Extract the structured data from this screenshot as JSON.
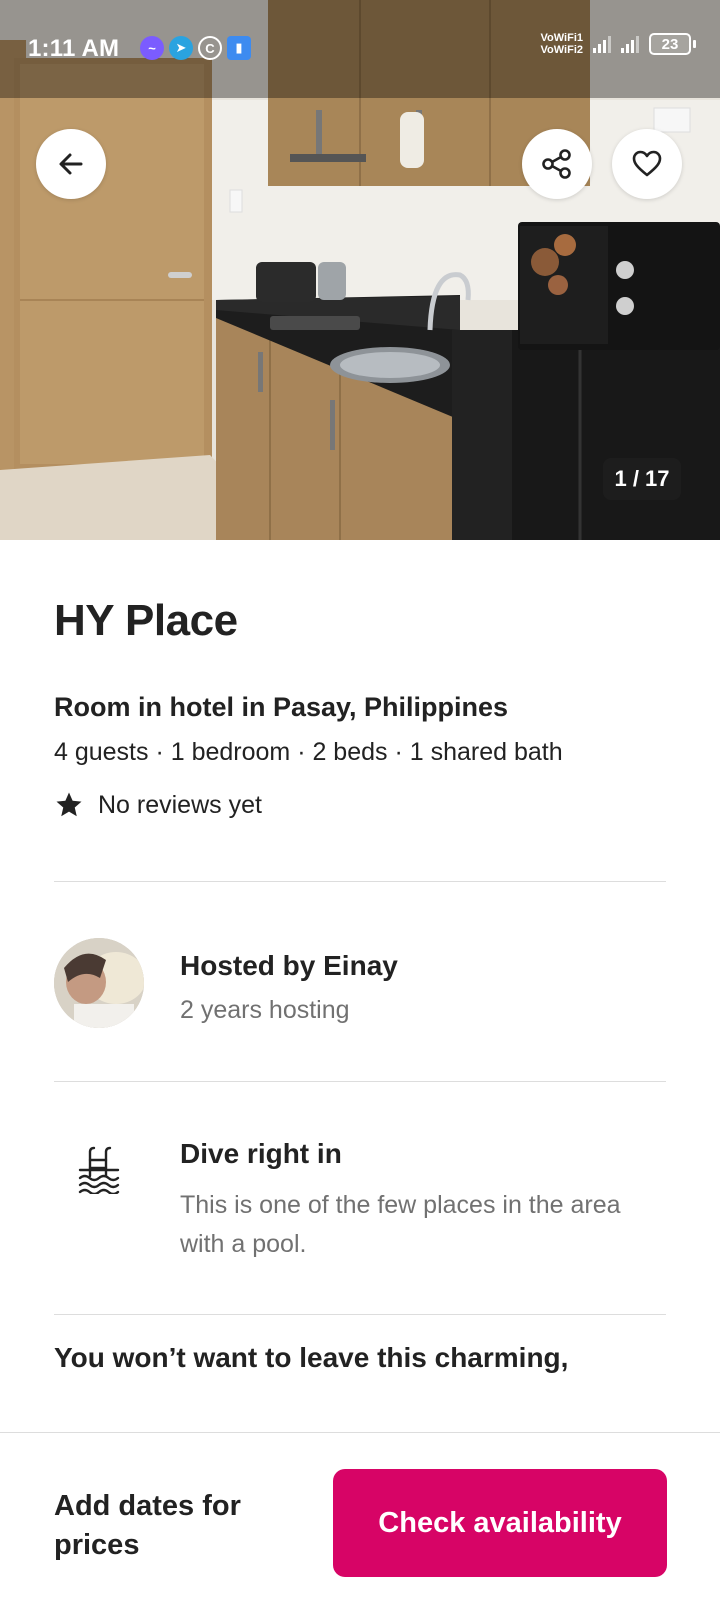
{
  "status_bar": {
    "time": "1:11 AM",
    "vowifi_1": "VoWiFi1",
    "vowifi_2": "VoWiFi2",
    "battery": "23",
    "icons": [
      "messenger-icon",
      "telegram-icon",
      "c-app-icon",
      "notification-icon"
    ]
  },
  "photo": {
    "counter": "1 / 17",
    "buttons": [
      "back-arrow-icon",
      "share-icon",
      "heart-icon"
    ]
  },
  "listing": {
    "title": "HY Place",
    "subtitle": "Room in hotel in Pasay, Philippines",
    "details": "4 guests · 1 bedroom · 2 beds · 1 shared bath",
    "reviews": "No reviews yet"
  },
  "host": {
    "name": "Hosted by Einay",
    "tenure": "2 years hosting"
  },
  "highlight": {
    "icon": "pool-icon",
    "title": "Dive right in",
    "description": "This is one of the few places in the area with a pool."
  },
  "description_teaser": "You won’t want to leave this charming,",
  "footer": {
    "price_prompt": "Add dates for prices",
    "cta_label": "Check availability"
  },
  "colors": {
    "brand": "#d70466",
    "text_primary": "#222222",
    "text_secondary": "#717171",
    "divider": "#dddddd"
  }
}
